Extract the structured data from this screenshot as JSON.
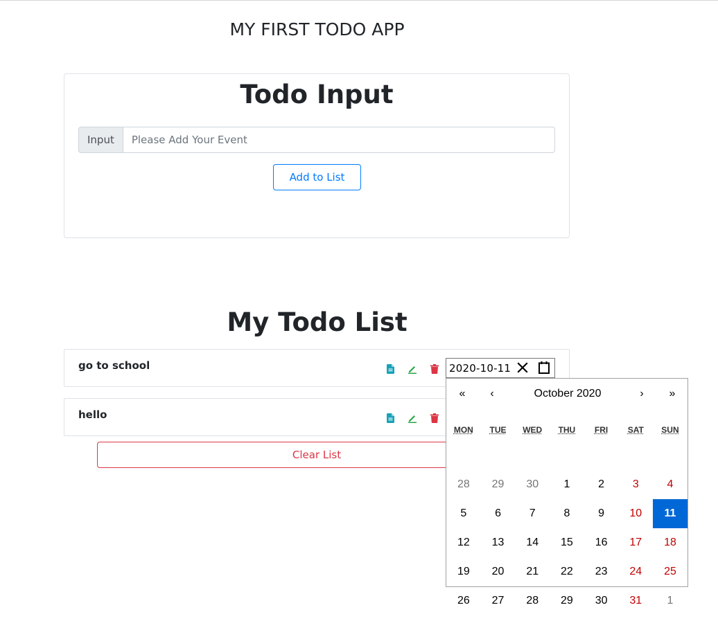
{
  "app": {
    "title": "MY FIRST TODO APP"
  },
  "input_card": {
    "heading": "Todo Input",
    "prepend_label": "Input",
    "placeholder": "Please Add Your Event",
    "value": "",
    "add_button": "Add to List"
  },
  "list": {
    "heading": "My Todo List",
    "items": [
      {
        "label": "go to school",
        "icons": [
          "file-icon",
          "edit-icon",
          "trash-icon"
        ]
      },
      {
        "label": "hello",
        "icons": [
          "file-icon",
          "edit-icon",
          "trash-icon"
        ]
      }
    ],
    "clear_button": "Clear List"
  },
  "date_picker": {
    "value": "2020-10-11",
    "clear_symbol": "✕",
    "month_label": "October 2020",
    "nav": {
      "prev_year": "«",
      "prev_month": "‹",
      "next_month": "›",
      "next_year": "»"
    },
    "weekdays": [
      "MON",
      "TUE",
      "WED",
      "THU",
      "FRI",
      "SAT",
      "SUN"
    ],
    "weeks": [
      [
        "28",
        "29",
        "30",
        "1",
        "2",
        "3",
        "4"
      ],
      [
        "5",
        "6",
        "7",
        "8",
        "9",
        "10",
        "11"
      ],
      [
        "12",
        "13",
        "14",
        "15",
        "16",
        "17",
        "18"
      ],
      [
        "19",
        "20",
        "21",
        "22",
        "23",
        "24",
        "25"
      ],
      [
        "26",
        "27",
        "28",
        "29",
        "30",
        "31",
        "1"
      ]
    ],
    "selected_day": "11"
  },
  "colors": {
    "primary": "#007bff",
    "danger": "#dc3545",
    "info_icon": "#17a2b8",
    "edit_icon": "#28a745",
    "delete_icon": "#dc3545",
    "calendar_selected": "#0067d6",
    "weekend_text": "#c00000"
  }
}
